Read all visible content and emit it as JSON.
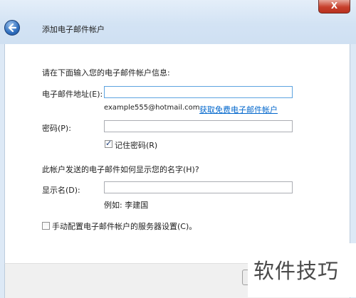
{
  "window": {
    "title": "添加电子邮件帐户",
    "close_glyph": "X"
  },
  "form": {
    "intro": "请在下面输入您的电子邮件帐户信息:",
    "email_label": "电子邮件地址(E):",
    "email_value": "",
    "email_example": "example555@hotmail.com",
    "get_account_link": "获取免费电子邮件帐户",
    "password_label": "密码(P):",
    "password_value": "",
    "remember_password_label": "记住密码(R)",
    "remember_password_checked": true,
    "display_question": "此帐户发送的电子邮件如何显示您的名字(H)?",
    "display_name_label": "显示名(D):",
    "display_name_value": "",
    "display_name_example": "例如: 李建国",
    "manual_config_label": "手动配置电子邮件帐户的服务器设置(C)。",
    "manual_config_checked": false
  },
  "watermark": {
    "text": "软件技巧"
  }
}
